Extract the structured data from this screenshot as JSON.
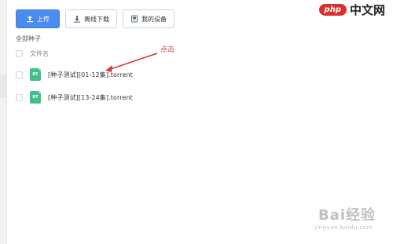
{
  "toolbar": {
    "upload_label": "上传",
    "offline_download_label": "离线下载",
    "my_devices_label": "我的设备"
  },
  "section_title": "全部种子",
  "list": {
    "header": "文件名",
    "files": [
      {
        "icon_text": "BT",
        "name": "[种子测试][01-12集].torrent"
      },
      {
        "icon_text": "BT",
        "name": "[种子测试][13-24集].torrent"
      }
    ]
  },
  "annotation": {
    "text": "点击",
    "color": "#d23a3a"
  },
  "watermarks": {
    "php_logo": "php",
    "php_cn": "中文网",
    "baidu_main": "Bai",
    "baidu_suffix": "经验",
    "baidu_url": "jingyan.baidu.com"
  },
  "colors": {
    "primary": "#4a8bf0",
    "file_icon": "#3fbf8a"
  }
}
